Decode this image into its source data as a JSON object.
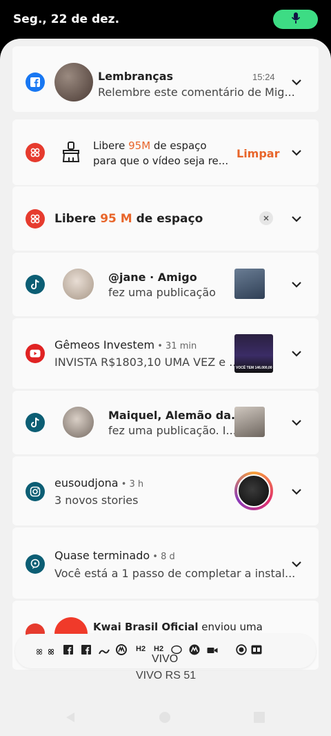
{
  "status": {
    "date": "Seg., 22 de dez."
  },
  "notifications": {
    "facebook": {
      "icon": "facebook-icon",
      "title": "Lembranças",
      "time": "15:24",
      "text": "Relembre este comentário de Mig..."
    },
    "cleaner1": {
      "icon": "cleaner-app-icon",
      "text_a": "Libere ",
      "highlight": "95M",
      "text_b": " de espaço",
      "line2": "para que o vídeo seja re...",
      "action": "Limpar"
    },
    "cleaner2": {
      "icon": "cleaner-app-icon",
      "text_a": "Libere ",
      "highlight": "95 M",
      "text_b": " de espaço"
    },
    "tiktok1": {
      "icon": "tiktok-icon",
      "title": "@jane · Amigo",
      "text": "fez uma publicação"
    },
    "youtube": {
      "icon": "youtube-icon",
      "title": "Gêmeos Investem",
      "meta": " • 31 min",
      "text": "INVISTA R$1803,10 UMA VEZ e ..",
      "thumb_text": "VOCÊ TEM 146.000,00"
    },
    "tiktok2": {
      "icon": "tiktok-icon",
      "title": "Maiquel, Alemão da...",
      "text": "fez uma publicação. I..."
    },
    "instagram": {
      "icon": "instagram-icon",
      "title": "eusoudjona",
      "meta": " • 3 h",
      "text": "3 novos stories"
    },
    "chat": {
      "icon": "chat-app-icon",
      "title": "Quase terminado",
      "meta": " • 8 d",
      "text": "Você está a 1 passo de completar a instal..."
    },
    "kwai": {
      "icon": "cleaner-app-icon",
      "title": "Kwai Brasil Oficial",
      "text": " enviou uma"
    }
  },
  "dock": {
    "labels": [
      "H2",
      "H2"
    ]
  },
  "carrier": {
    "line1": "VIVO",
    "line2": "VIVO RS 51"
  }
}
